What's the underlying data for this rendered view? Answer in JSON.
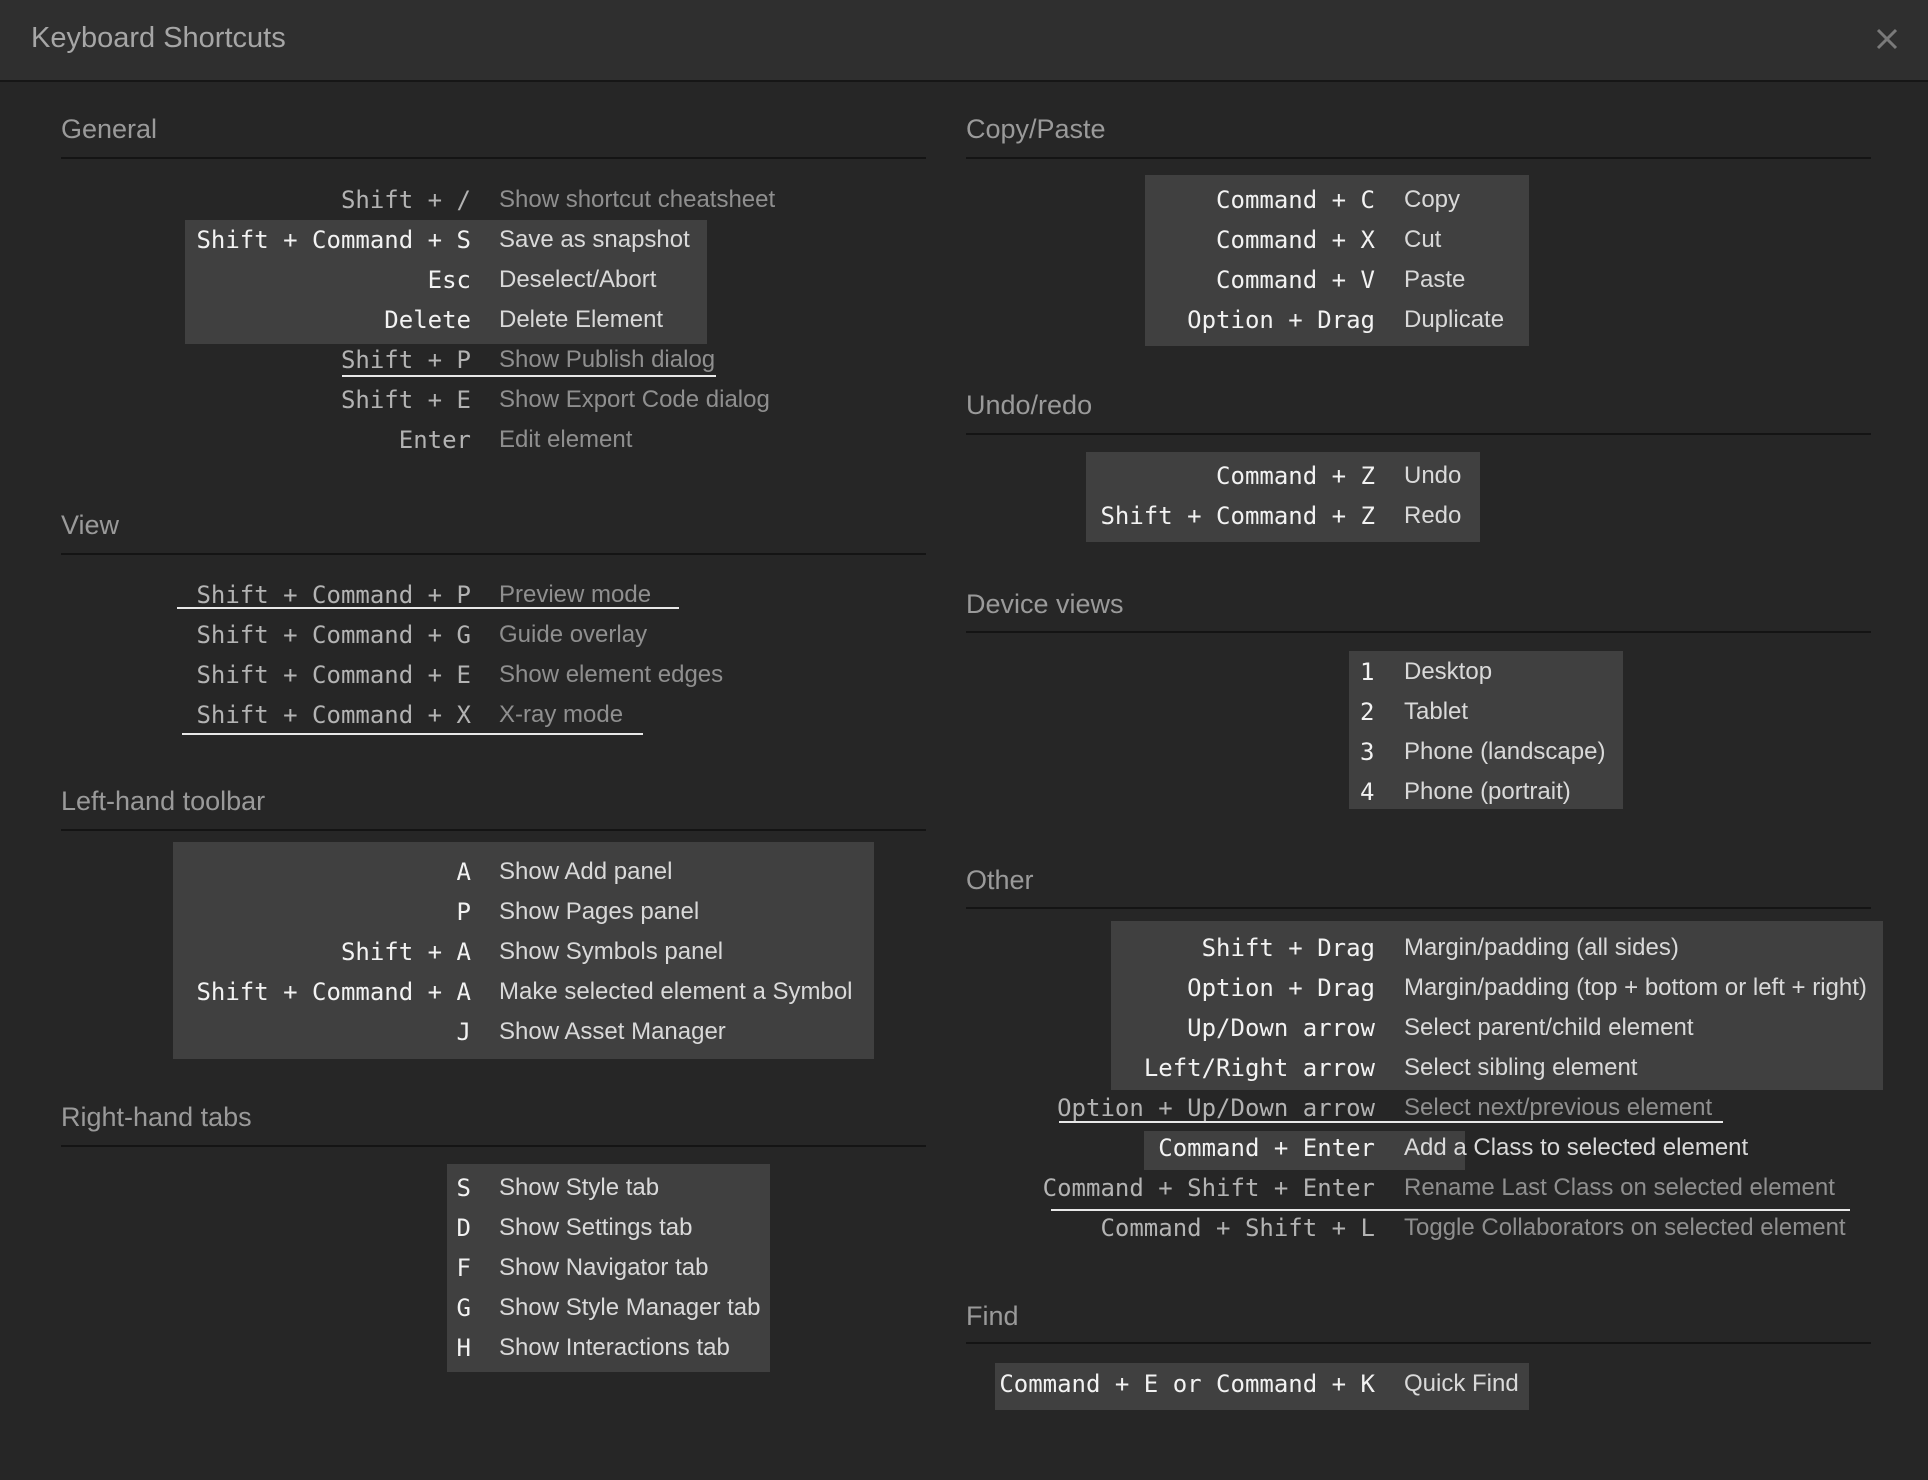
{
  "header": {
    "title": "Keyboard Shortcuts",
    "close_icon": "close-icon"
  },
  "sections": {
    "general": {
      "title": "General",
      "rows": [
        {
          "key": "Shift + /",
          "desc": "Show shortcut cheatsheet"
        },
        {
          "key": "Shift + Command + S",
          "desc": "Save as snapshot"
        },
        {
          "key": "Esc",
          "desc": "Deselect/Abort"
        },
        {
          "key": "Delete",
          "desc": "Delete Element"
        },
        {
          "key": "Shift + P",
          "desc": "Show Publish dialog"
        },
        {
          "key": "Shift + E",
          "desc": "Show Export Code dialog"
        },
        {
          "key": "Enter",
          "desc": "Edit element"
        }
      ]
    },
    "view": {
      "title": "View",
      "rows": [
        {
          "key": "Shift + Command + P",
          "desc": "Preview mode"
        },
        {
          "key": "Shift + Command + G",
          "desc": "Guide overlay"
        },
        {
          "key": "Shift + Command + E",
          "desc": "Show element edges"
        },
        {
          "key": "Shift + Command + X",
          "desc": "X-ray mode"
        }
      ]
    },
    "left_toolbar": {
      "title": "Left-hand toolbar",
      "rows": [
        {
          "key": "A",
          "desc": "Show Add panel"
        },
        {
          "key": "P",
          "desc": "Show Pages panel"
        },
        {
          "key": "Shift + A",
          "desc": "Show Symbols panel"
        },
        {
          "key": "Shift + Command + A",
          "desc": "Make selected element a Symbol"
        },
        {
          "key": "J",
          "desc": "Show Asset Manager"
        }
      ]
    },
    "right_tabs": {
      "title": "Right-hand tabs",
      "rows": [
        {
          "key": "S",
          "desc": "Show Style tab"
        },
        {
          "key": "D",
          "desc": "Show Settings tab"
        },
        {
          "key": "F",
          "desc": "Show Navigator tab"
        },
        {
          "key": "G",
          "desc": "Show Style Manager tab"
        },
        {
          "key": "H",
          "desc": "Show Interactions tab"
        }
      ]
    },
    "copy_paste": {
      "title": "Copy/Paste",
      "rows": [
        {
          "key": "Command + C",
          "desc": "Copy"
        },
        {
          "key": "Command + X",
          "desc": "Cut"
        },
        {
          "key": "Command + V",
          "desc": "Paste"
        },
        {
          "key": "Option + Drag",
          "desc": "Duplicate"
        }
      ]
    },
    "undo_redo": {
      "title": "Undo/redo",
      "rows": [
        {
          "key": "Command + Z",
          "desc": "Undo"
        },
        {
          "key": "Shift + Command + Z",
          "desc": "Redo"
        }
      ]
    },
    "device_views": {
      "title": "Device views",
      "rows": [
        {
          "key": "1",
          "desc": "Desktop"
        },
        {
          "key": "2",
          "desc": "Tablet"
        },
        {
          "key": "3",
          "desc": "Phone (landscape)"
        },
        {
          "key": "4",
          "desc": "Phone (portrait)"
        }
      ]
    },
    "other": {
      "title": "Other",
      "rows": [
        {
          "key": "Shift + Drag",
          "desc": "Margin/padding (all sides)"
        },
        {
          "key": "Option + Drag",
          "desc": "Margin/padding (top + bottom or left + right)"
        },
        {
          "key": "Up/Down arrow",
          "desc": "Select parent/child element"
        },
        {
          "key": "Left/Right arrow",
          "desc": "Select sibling element"
        },
        {
          "key": "Option + Up/Down arrow",
          "desc": "Select next/previous element"
        },
        {
          "key": "Command + Enter",
          "desc": "Add a Class to selected element"
        },
        {
          "key": "Command + Shift + Enter",
          "desc": "Rename Last Class on selected element"
        },
        {
          "key": "Command + Shift + L",
          "desc": "Toggle Collaborators on selected element"
        }
      ]
    },
    "find": {
      "title": "Find",
      "rows": [
        {
          "key": "Command + E or Command + K",
          "desc": "Quick Find"
        }
      ]
    }
  }
}
